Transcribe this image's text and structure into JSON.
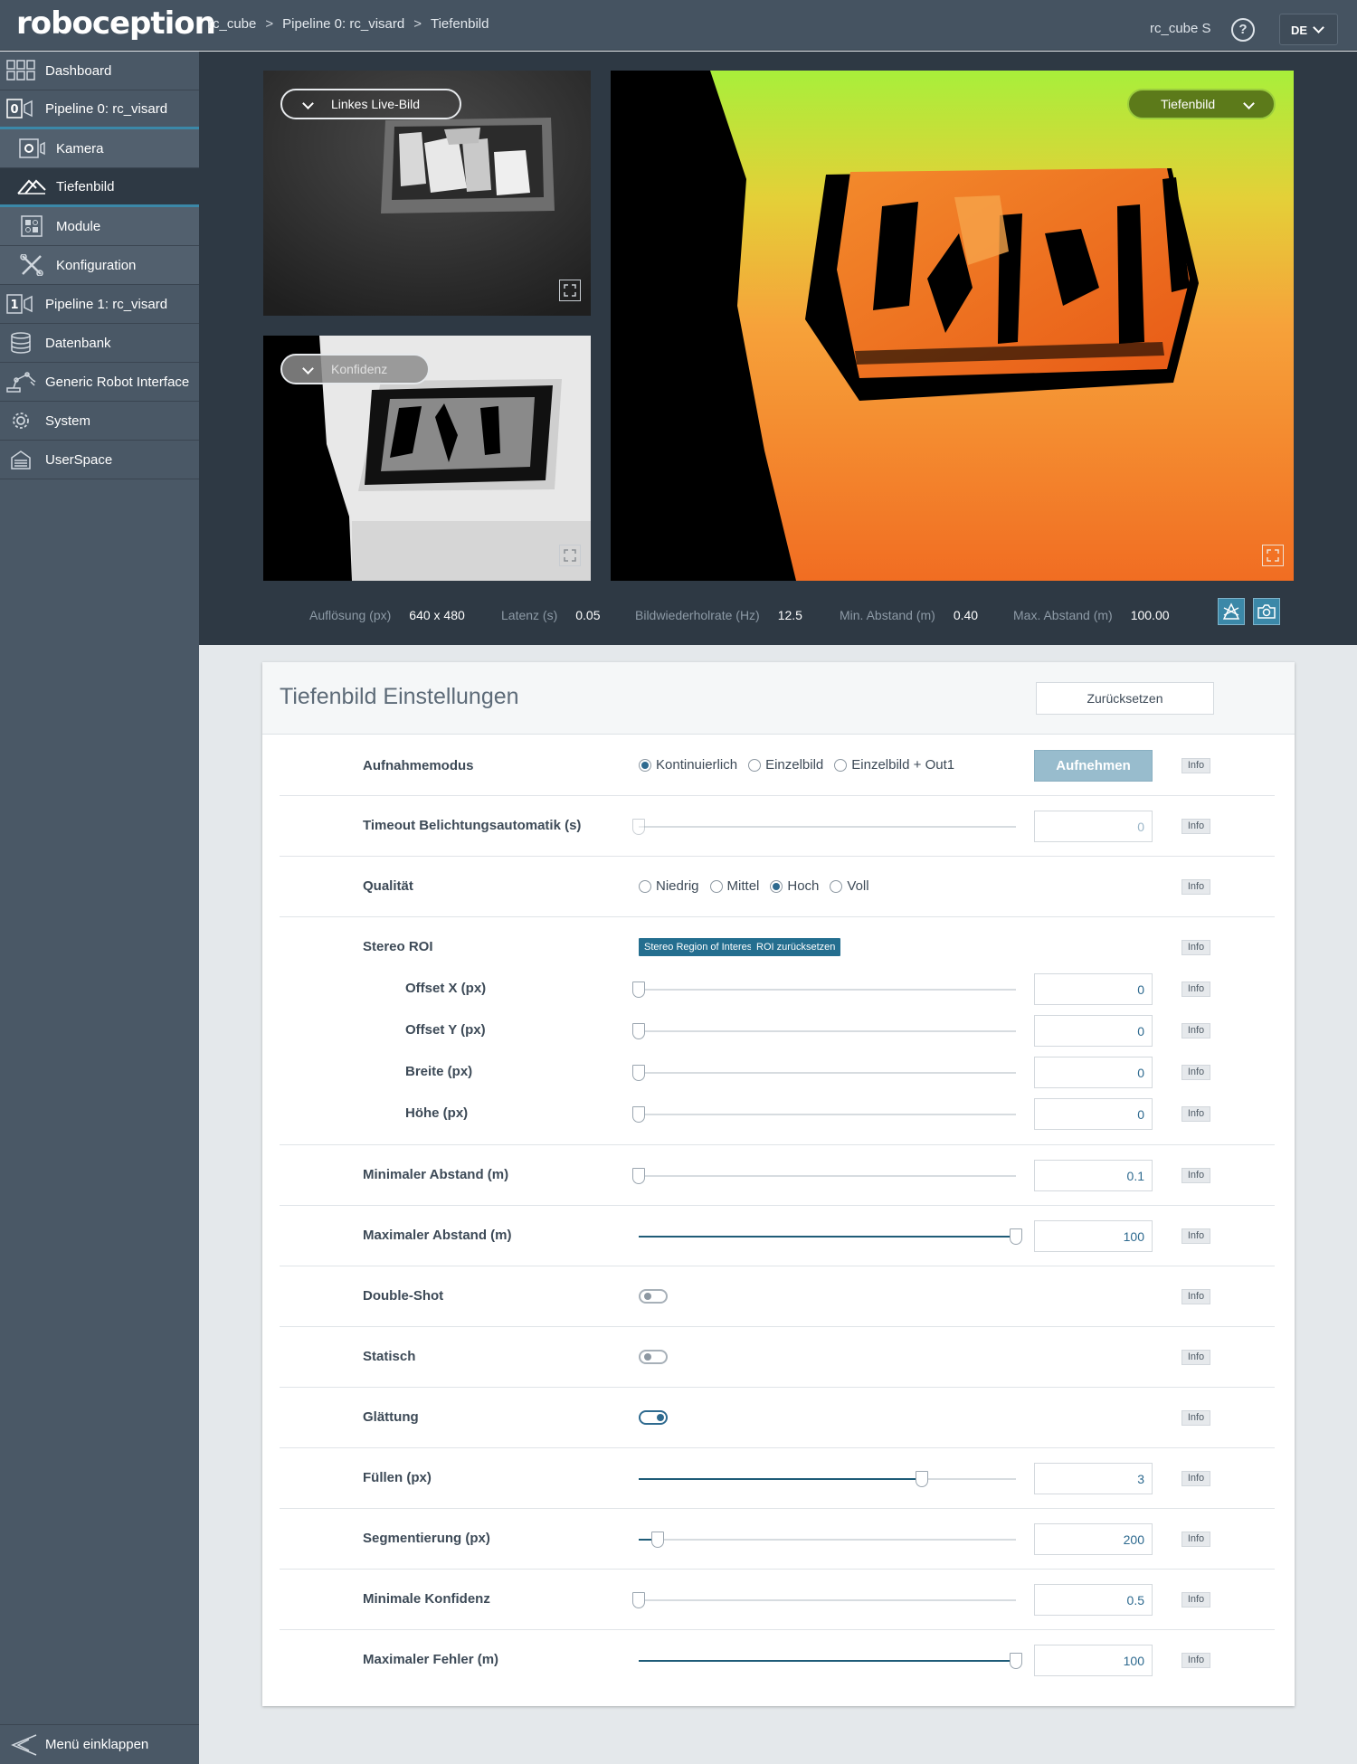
{
  "app": {
    "logo": "roboception",
    "device": "rc_cube S",
    "help": "?",
    "lang": "DE"
  },
  "breadcrumb": [
    "rc_cube",
    ">",
    "Pipeline 0: rc_visard",
    ">",
    "Tiefenbild"
  ],
  "sidebar": {
    "items": [
      {
        "label": "Dashboard",
        "icon": "dashboard-grid-icon"
      },
      {
        "label": "Pipeline 0: rc_visard",
        "icon": "pipeline-0-icon"
      },
      {
        "label": "Kamera",
        "icon": "camera-icon"
      },
      {
        "label": "Tiefenbild",
        "icon": "depth-image-icon"
      },
      {
        "label": "Module",
        "icon": "modules-icon"
      },
      {
        "label": "Konfiguration",
        "icon": "tools-icon"
      },
      {
        "label": "Pipeline 1: rc_visard",
        "icon": "pipeline-1-icon"
      },
      {
        "label": "Datenbank",
        "icon": "database-icon"
      },
      {
        "label": "Generic Robot Interface",
        "icon": "robot-arm-icon"
      },
      {
        "label": "System",
        "icon": "gear-icon"
      },
      {
        "label": "UserSpace",
        "icon": "userspace-icon"
      }
    ],
    "collapse": "Menü einklappen"
  },
  "views": {
    "left": "Linkes Live-Bild",
    "confidence": "Konfidenz",
    "depth": "Tiefenbild"
  },
  "stats": {
    "resolution_label": "Auflösung (px)",
    "resolution": "640 x 480",
    "latency_label": "Latenz (s)",
    "latency": "0.05",
    "fps_label": "Bildwiederholrate (Hz)",
    "fps": "12.5",
    "min_label": "Min. Abstand (m)",
    "min": "0.40",
    "max_label": "Max. Abstand (m)",
    "max": "100.00"
  },
  "settings": {
    "title": "Tiefenbild Einstellungen",
    "reset": "Zurücksetzen",
    "info": "Info",
    "mode": {
      "label": "Aufnahmemodus",
      "options": [
        "Kontinuierlich",
        "Einzelbild",
        "Einzelbild + Out1"
      ],
      "selected": 0,
      "button": "Aufnehmen"
    },
    "timeout": {
      "label": "Timeout Belichtungsautomatik (s)",
      "value": "0",
      "level": 0
    },
    "quality": {
      "label": "Qualität",
      "options": [
        "Niedrig",
        "Mittel",
        "Hoch",
        "Voll"
      ],
      "selected": 2
    },
    "roi": {
      "label": "Stereo ROI",
      "tag1": "Stereo Region of Interest",
      "tag2": "ROI zurücksetzen",
      "fields": [
        {
          "label": "Offset X (px)",
          "value": "0",
          "level": 0
        },
        {
          "label": "Offset Y (px)",
          "value": "0",
          "level": 0
        },
        {
          "label": "Breite (px)",
          "value": "0",
          "level": 0
        },
        {
          "label": "Höhe (px)",
          "value": "0",
          "level": 0
        }
      ]
    },
    "min_dist": {
      "label": "Minimaler Abstand (m)",
      "value": "0.1",
      "level": 0
    },
    "max_dist": {
      "label": "Maximaler Abstand (m)",
      "value": "100",
      "level": 1
    },
    "double_shot": {
      "label": "Double-Shot",
      "on": false
    },
    "static": {
      "label": "Statisch",
      "on": false
    },
    "smoothing": {
      "label": "Glättung",
      "on": true
    },
    "fill": {
      "label": "Füllen (px)",
      "value": "3",
      "level": 0.75
    },
    "segmentation": {
      "label": "Segmentierung (px)",
      "value": "200",
      "level": 0.05
    },
    "min_conf": {
      "label": "Minimale Konfidenz",
      "value": "0.5",
      "level": 0
    },
    "max_err": {
      "label": "Maximaler Fehler (m)",
      "value": "100",
      "level": 1
    }
  },
  "colors": {
    "accent": "#2e6a8f",
    "active_bar": "#3b88a8",
    "header": "#455361",
    "sidebar": "#4a5866",
    "viewer_bg": "#2e3944",
    "depth_select": "#5c7a1a"
  }
}
